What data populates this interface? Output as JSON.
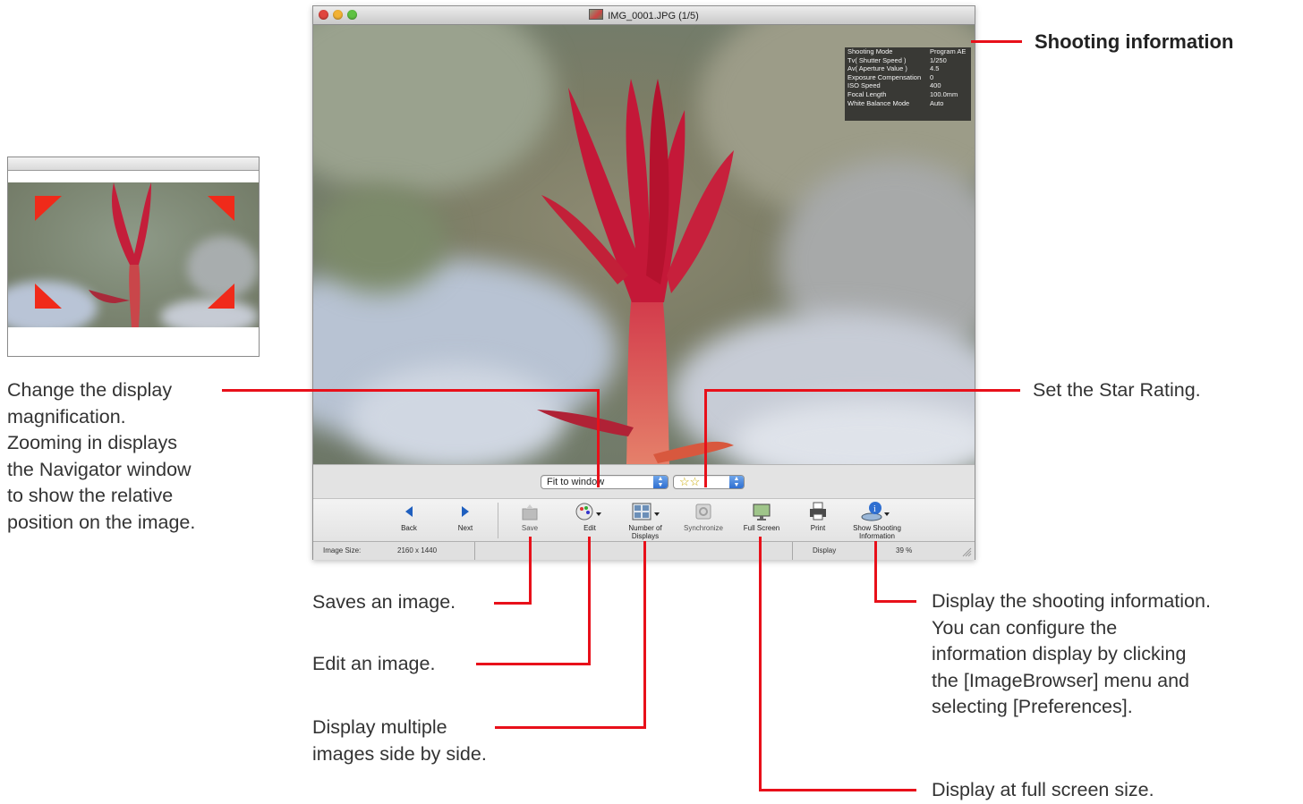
{
  "window": {
    "title": "IMG_0001.JPG (1/5)",
    "traffic_colors": [
      "#e0463f",
      "#f2b233",
      "#5fc242"
    ]
  },
  "shooting_info": [
    {
      "key": "Shooting Mode",
      "value": "Program AE"
    },
    {
      "key": "Tv( Shutter Speed )",
      "value": "1/250"
    },
    {
      "key": "Av( Aperture Value )",
      "value": "4.5"
    },
    {
      "key": "Exposure Compensation",
      "value": "0"
    },
    {
      "key": "ISO Speed",
      "value": "400"
    },
    {
      "key": "Focal Length",
      "value": "100.0mm"
    },
    {
      "key": "White Balance Mode",
      "value": "Auto"
    }
  ],
  "magnification_select": {
    "value": "Fit to window"
  },
  "star_rating_select": {
    "value": "☆☆",
    "stars": 2
  },
  "toolbar": {
    "back": "Back",
    "next": "Next",
    "save": "Save",
    "edit": "Edit",
    "number_of_displays": "Number of Displays",
    "synchronize": "Synchronize",
    "full_screen": "Full Screen",
    "print": "Print",
    "show_shooting_info": "Show Shooting Information"
  },
  "status": {
    "image_size_label": "Image Size:",
    "image_size_value": "2160 x 1440",
    "display_label": "Display",
    "display_value": "39 %"
  },
  "annotations": {
    "shooting_information": "Shooting information",
    "magnification": [
      "Change the display",
      "magnification.",
      "Zooming in displays",
      "the Navigator window",
      "to show the relative",
      "position on the image."
    ],
    "star_rating": "Set the Star Rating.",
    "save": "Saves an image.",
    "edit": "Edit an image.",
    "multiple": [
      "Display multiple",
      "images side by side."
    ],
    "shooting_display": [
      "Display the shooting information.",
      "You can configure the",
      "information display by clicking",
      "the [ImageBrowser] menu and",
      "selecting [Preferences]."
    ],
    "full_screen": "Display at full screen size."
  },
  "colors": {
    "callout": "#e8101a",
    "accent_blue": "#2f6fd1"
  }
}
